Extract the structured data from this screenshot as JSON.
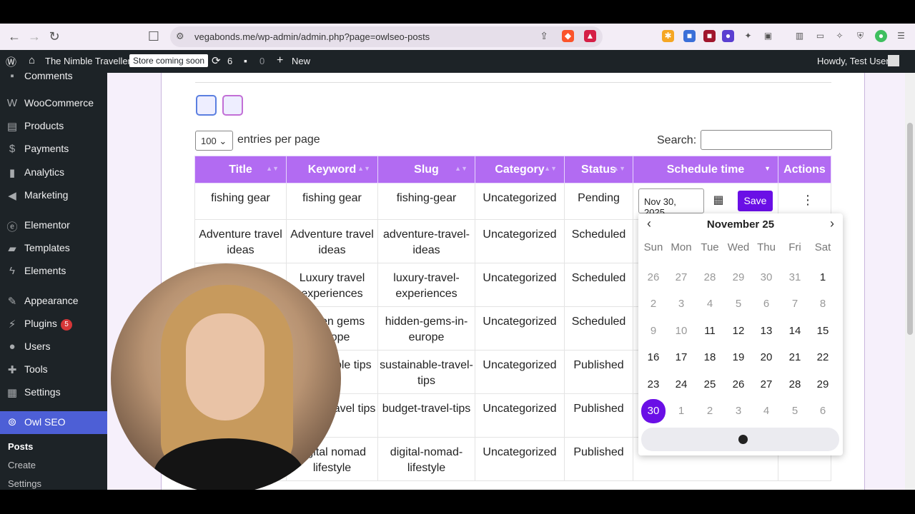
{
  "browser": {
    "url": "vegabonds.me/wp-admin/admin.php?page=owlseo-posts"
  },
  "adminbar": {
    "site_name": "The Nimble Traveller",
    "store_badge": "Store coming soon",
    "updates_count": "6",
    "comments_count": "0",
    "new_label": "New",
    "greeting": "Howdy, Test User"
  },
  "sidebar": {
    "items": [
      {
        "label": "Comments",
        "icon": "comment-icon"
      },
      {
        "label": "WooCommerce",
        "icon": "woocommerce-icon"
      },
      {
        "label": "Products",
        "icon": "archive-icon"
      },
      {
        "label": "Payments",
        "icon": "dollar-icon"
      },
      {
        "label": "Analytics",
        "icon": "bar-chart-icon"
      },
      {
        "label": "Marketing",
        "icon": "megaphone-icon"
      },
      {
        "label": "Elementor",
        "icon": "elementor-icon"
      },
      {
        "label": "Templates",
        "icon": "folder-icon"
      },
      {
        "label": "Elements",
        "icon": "bolt-icon"
      },
      {
        "label": "Appearance",
        "icon": "paintbrush-icon"
      },
      {
        "label": "Plugins",
        "icon": "plug-icon",
        "badge": "5"
      },
      {
        "label": "Users",
        "icon": "user-icon"
      },
      {
        "label": "Tools",
        "icon": "wrench-icon"
      },
      {
        "label": "Settings",
        "icon": "settings-icon"
      },
      {
        "label": "Owl SEO",
        "icon": "owl-icon"
      }
    ],
    "submenu": [
      "Posts",
      "Create",
      "Settings"
    ]
  },
  "table_controls": {
    "per_page_value": "100",
    "per_page_label": "entries per page",
    "search_label": "Search:"
  },
  "table": {
    "headers": [
      "Title",
      "Keyword",
      "Slug",
      "Category",
      "Status",
      "Schedule time",
      "Actions"
    ],
    "rows": [
      [
        "fishing gear",
        "fishing gear",
        "fishing-gear",
        "Uncategorized",
        "Pending"
      ],
      [
        "Adventure travel ideas",
        "Adventure travel ideas",
        "adventure-travel-ideas",
        "Uncategorized",
        "Scheduled"
      ],
      [
        "",
        "Luxury travel experiences",
        "luxury-travel-experiences",
        "Uncategorized",
        "Scheduled"
      ],
      [
        "",
        "hidden gems europe",
        "hidden-gems-in-europe",
        "Uncategorized",
        "Scheduled"
      ],
      [
        "",
        "sustainable tips",
        "sustainable-travel-tips",
        "Uncategorized",
        "Published"
      ],
      [
        "",
        "budget travel tips",
        "budget-travel-tips",
        "Uncategorized",
        "Published"
      ],
      [
        "",
        "digital nomad lifestyle",
        "digital-nomad-lifestyle",
        "Uncategorized",
        "Published"
      ]
    ]
  },
  "schedule": {
    "date_value": "Nov 30, 2025",
    "save_label": "Save"
  },
  "calendar": {
    "month_label": "November 25",
    "weekdays": [
      "Sun",
      "Mon",
      "Tue",
      "Wed",
      "Thu",
      "Fri",
      "Sat"
    ],
    "weeks": [
      [
        "26",
        "27",
        "28",
        "29",
        "30",
        "31",
        "1"
      ],
      [
        "2",
        "3",
        "4",
        "5",
        "6",
        "7",
        "8"
      ],
      [
        "9",
        "10",
        "11",
        "12",
        "13",
        "14",
        "15"
      ],
      [
        "16",
        "17",
        "18",
        "19",
        "20",
        "21",
        "22"
      ],
      [
        "23",
        "24",
        "25",
        "26",
        "27",
        "28",
        "29"
      ],
      [
        "30",
        "1",
        "2",
        "3",
        "4",
        "5",
        "6"
      ]
    ],
    "selected": "30",
    "accent": "#6a0fe6"
  },
  "colors": {
    "header_purple": "#b26bf2",
    "wp_dark": "#1d2327",
    "active_menu": "#4d5fd6"
  }
}
